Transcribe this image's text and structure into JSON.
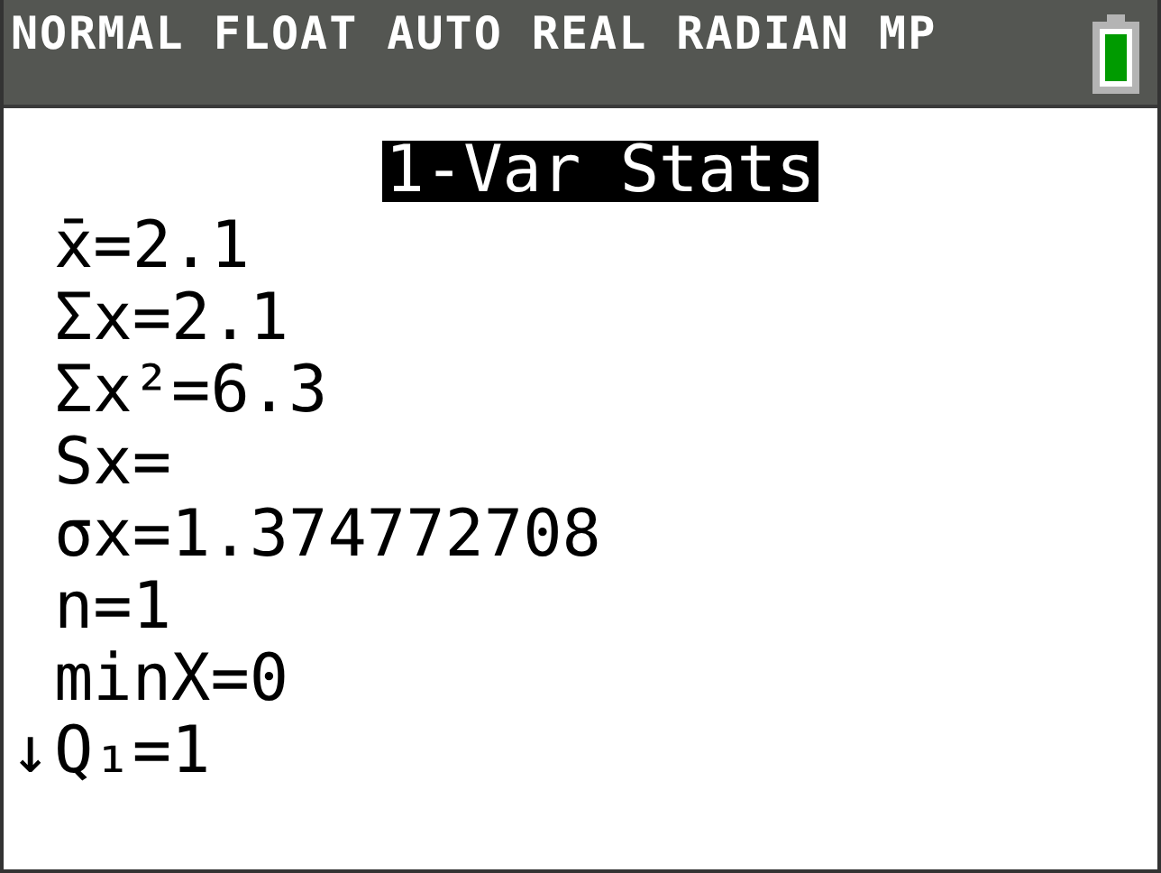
{
  "status_bar": {
    "modes": "NORMAL FLOAT AUTO REAL RADIAN MP"
  },
  "screen": {
    "title": "1-Var Stats",
    "rows": [
      {
        "marker": "",
        "text": "x̄=2.1"
      },
      {
        "marker": "",
        "text": "Σx=2.1"
      },
      {
        "marker": "",
        "text": "Σx²=6.3"
      },
      {
        "marker": "",
        "text": "Sx="
      },
      {
        "marker": "",
        "text": "σx=1.374772708"
      },
      {
        "marker": "",
        "text": "n=1"
      },
      {
        "marker": "",
        "text": "minX=0"
      },
      {
        "marker": "↓",
        "text": "Q₁=1"
      }
    ]
  }
}
